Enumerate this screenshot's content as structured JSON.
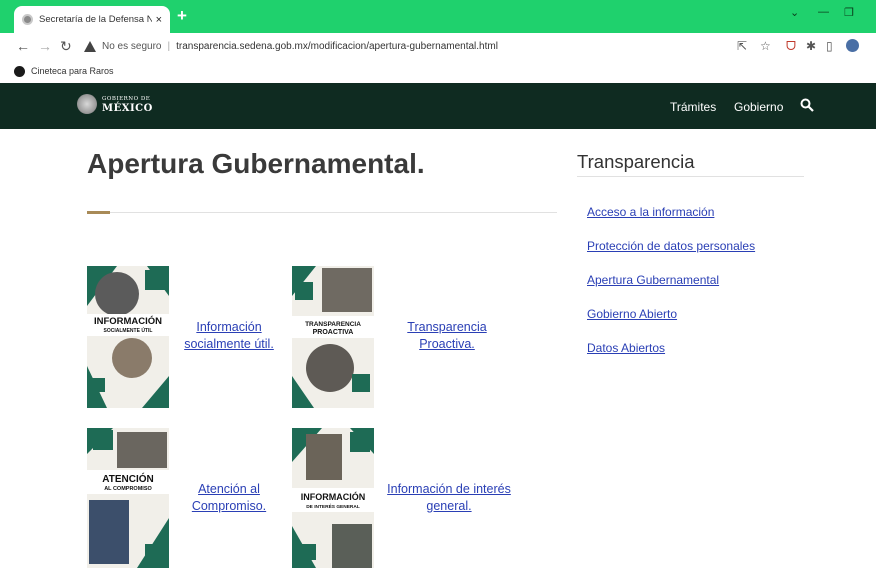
{
  "browser": {
    "tab_title": "Secretaría de la Defensa Naciona",
    "tab_close": "×",
    "new_tab": "+",
    "security_label": "No es seguro",
    "url": "transparencia.sedena.gob.mx/modificacion/apertura-gubernamental.html",
    "bookmark": "Cineteca para Raros"
  },
  "header": {
    "logo_small": "GOBIERNO DE",
    "logo_big": "MÉXICO",
    "nav": [
      "Trámites",
      "Gobierno"
    ]
  },
  "main": {
    "title": "Apertura Gubernamental.",
    "cards": [
      {
        "link": "Información socialmente útil.",
        "image_title": "INFORMACIÓN",
        "image_subtitle": "SOCIALMENTE ÚTIL"
      },
      {
        "link": "Transparencia Proactiva.",
        "image_title": "TRANSPARENCIA",
        "image_subtitle": "PROACTIVA"
      },
      {
        "link": "Atención al Compromiso.",
        "image_title": "ATENCIÓN",
        "image_subtitle": "AL COMPROMISO"
      },
      {
        "link": "Información de interés general.",
        "image_title": "INFORMACIÓN",
        "image_subtitle": "DE INTERÉS GENERAL"
      }
    ]
  },
  "sidebar": {
    "title": "Transparencia",
    "links": [
      "Acceso a la información",
      "Protección de datos personales",
      "Apertura Gubernamental",
      "Gobierno Abierto",
      "Datos Abiertos"
    ]
  },
  "colors": {
    "tabbar": "#1fd16d",
    "header": "#0f2b21",
    "accent": "#a88a57",
    "link": "#2a3fb5",
    "card_green": "#1e6b55"
  }
}
